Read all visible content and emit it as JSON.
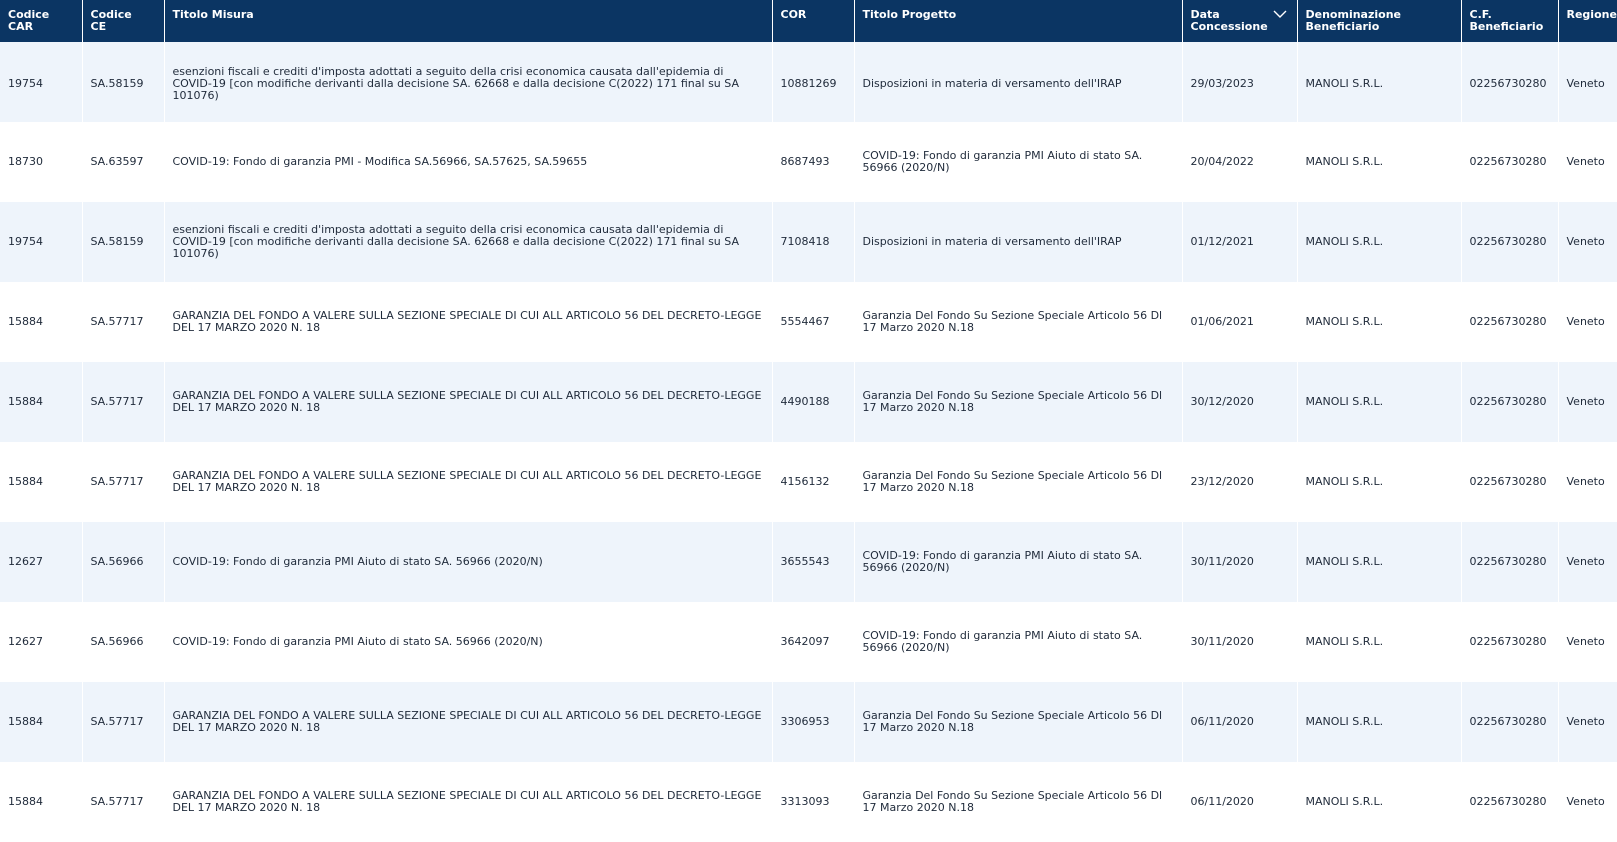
{
  "table": {
    "headers": {
      "codice_car": [
        "Codice",
        "CAR"
      ],
      "codice_ce": [
        "Codice",
        "CE"
      ],
      "titolo_misura": "Titolo Misura",
      "cor": "COR",
      "titolo_progetto": "Titolo Progetto",
      "data_concessione": [
        "Data",
        "Concessione"
      ],
      "denominazione": [
        "Denominazione",
        "Beneficiario"
      ],
      "cf": [
        "C.F.",
        "Beneficiario"
      ],
      "regione": "Regione"
    },
    "sort_icon": "chevron-down-icon",
    "rows": [
      {
        "car": "19754",
        "ce": "SA.58159",
        "misura": "esenzioni fiscali e crediti d'imposta adottati a seguito della crisi economica causata dall'epidemia di COVID-19 [con modifiche derivanti dalla decisione SA. 62668 e dalla decisione C(2022) 171 final su SA 101076)",
        "cor": "10881269",
        "progetto": "Disposizioni in materia di versamento dell'IRAP",
        "data": "29/03/2023",
        "denominazione": "MANOLI S.R.L.",
        "cf": "02256730280",
        "regione": "Veneto"
      },
      {
        "car": "18730",
        "ce": "SA.63597",
        "misura": "COVID-19: Fondo di garanzia PMI - Modifica SA.56966, SA.57625, SA.59655",
        "cor": "8687493",
        "progetto": "COVID-19: Fondo di garanzia PMI Aiuto di stato SA. 56966 (2020/N)",
        "data": "20/04/2022",
        "denominazione": "MANOLI S.R.L.",
        "cf": "02256730280",
        "regione": "Veneto"
      },
      {
        "car": "19754",
        "ce": "SA.58159",
        "misura": "esenzioni fiscali e crediti d'imposta adottati a seguito della crisi economica causata dall'epidemia di COVID-19 [con modifiche derivanti dalla decisione SA. 62668 e dalla decisione C(2022) 171 final su SA 101076)",
        "cor": "7108418",
        "progetto": "Disposizioni in materia di versamento dell'IRAP",
        "data": "01/12/2021",
        "denominazione": "MANOLI S.R.L.",
        "cf": "02256730280",
        "regione": "Veneto"
      },
      {
        "car": "15884",
        "ce": "SA.57717",
        "misura": "GARANZIA DEL FONDO A VALERE SULLA SEZIONE SPECIALE DI CUI ALL ARTICOLO 56 DEL DECRETO-LEGGE DEL 17 MARZO 2020 N. 18",
        "cor": "5554467",
        "progetto": "Garanzia Del Fondo Su Sezione Speciale Articolo 56 Dl 17 Marzo 2020 N.18",
        "data": "01/06/2021",
        "denominazione": "MANOLI S.R.L.",
        "cf": "02256730280",
        "regione": "Veneto"
      },
      {
        "car": "15884",
        "ce": "SA.57717",
        "misura": "GARANZIA DEL FONDO A VALERE SULLA SEZIONE SPECIALE DI CUI ALL ARTICOLO 56 DEL DECRETO-LEGGE DEL 17 MARZO 2020 N. 18",
        "cor": "4490188",
        "progetto": "Garanzia Del Fondo Su Sezione Speciale Articolo 56 Dl 17 Marzo 2020 N.18",
        "data": "30/12/2020",
        "denominazione": "MANOLI S.R.L.",
        "cf": "02256730280",
        "regione": "Veneto"
      },
      {
        "car": "15884",
        "ce": "SA.57717",
        "misura": "GARANZIA DEL FONDO A VALERE SULLA SEZIONE SPECIALE DI CUI ALL ARTICOLO 56 DEL DECRETO-LEGGE DEL 17 MARZO 2020 N. 18",
        "cor": "4156132",
        "progetto": "Garanzia Del Fondo Su Sezione Speciale Articolo 56 Dl 17 Marzo 2020 N.18",
        "data": "23/12/2020",
        "denominazione": "MANOLI S.R.L.",
        "cf": "02256730280",
        "regione": "Veneto"
      },
      {
        "car": "12627",
        "ce": "SA.56966",
        "misura": "COVID-19: Fondo di garanzia PMI Aiuto di stato SA. 56966 (2020/N)",
        "cor": "3655543",
        "progetto": "COVID-19: Fondo di garanzia PMI Aiuto di stato SA. 56966 (2020/N)",
        "data": "30/11/2020",
        "denominazione": "MANOLI S.R.L.",
        "cf": "02256730280",
        "regione": "Veneto"
      },
      {
        "car": "12627",
        "ce": "SA.56966",
        "misura": "COVID-19: Fondo di garanzia PMI Aiuto di stato SA. 56966 (2020/N)",
        "cor": "3642097",
        "progetto": "COVID-19: Fondo di garanzia PMI Aiuto di stato SA. 56966 (2020/N)",
        "data": "30/11/2020",
        "denominazione": "MANOLI S.R.L.",
        "cf": "02256730280",
        "regione": "Veneto"
      },
      {
        "car": "15884",
        "ce": "SA.57717",
        "misura": "GARANZIA DEL FONDO A VALERE SULLA SEZIONE SPECIALE DI CUI ALL ARTICOLO 56 DEL DECRETO-LEGGE DEL 17 MARZO 2020 N. 18",
        "cor": "3306953",
        "progetto": "Garanzia Del Fondo Su Sezione Speciale Articolo 56 Dl 17 Marzo 2020 N.18",
        "data": "06/11/2020",
        "denominazione": "MANOLI S.R.L.",
        "cf": "02256730280",
        "regione": "Veneto"
      },
      {
        "car": "15884",
        "ce": "SA.57717",
        "misura": "GARANZIA DEL FONDO A VALERE SULLA SEZIONE SPECIALE DI CUI ALL ARTICOLO 56 DEL DECRETO-LEGGE DEL 17 MARZO 2020 N. 18",
        "cor": "3313093",
        "progetto": "Garanzia Del Fondo Su Sezione Speciale Articolo 56 Dl 17 Marzo 2020 N.18",
        "data": "06/11/2020",
        "denominazione": "MANOLI S.R.L.",
        "cf": "02256730280",
        "regione": "Veneto"
      }
    ]
  }
}
